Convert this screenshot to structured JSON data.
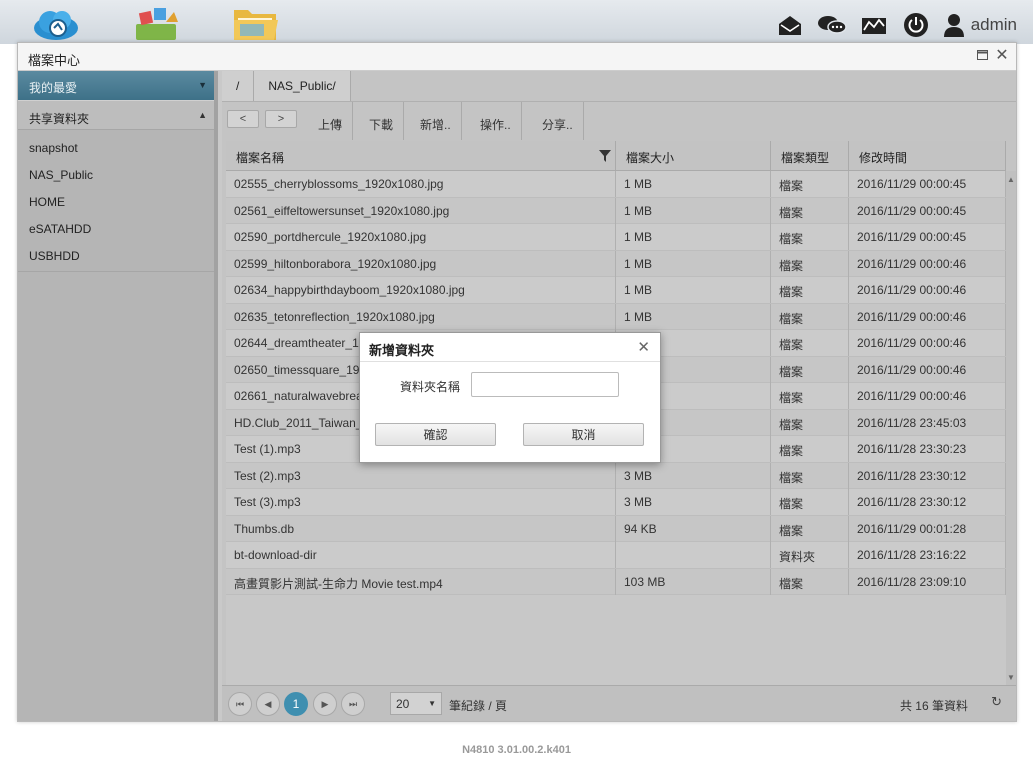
{
  "topbar": {
    "apps": [
      {
        "name": "cloud-app-icon"
      },
      {
        "name": "app-store-icon"
      },
      {
        "name": "file-center-icon"
      }
    ],
    "username": "admin"
  },
  "window": {
    "title": "檔案中心"
  },
  "sidebar": {
    "favorites_label": "我的最愛",
    "shared_label": "共享資料夾",
    "items": [
      {
        "label": "snapshot"
      },
      {
        "label": "NAS_Public"
      },
      {
        "label": "HOME"
      },
      {
        "label": "eSATAHDD"
      },
      {
        "label": "USBHDD"
      }
    ]
  },
  "breadcrumb": [
    "/",
    "NAS_Public/"
  ],
  "toolbar": {
    "back": "<",
    "forward": ">",
    "buttons": [
      {
        "label": "上傳"
      },
      {
        "label": "下載"
      },
      {
        "label": "新增.."
      },
      {
        "label": "操作.."
      },
      {
        "label": "分享.."
      }
    ]
  },
  "table": {
    "columns": [
      "檔案名稱",
      "檔案大小",
      "檔案類型",
      "修改時間"
    ],
    "rows": [
      {
        "name": "02555_cherryblossoms_1920x1080.jpg",
        "size": "1 MB",
        "type": "檔案",
        "modified": "2016/11/29 00:00:45"
      },
      {
        "name": "02561_eiffeltowersunset_1920x1080.jpg",
        "size": "1 MB",
        "type": "檔案",
        "modified": "2016/11/29 00:00:45"
      },
      {
        "name": "02590_portdhercule_1920x1080.jpg",
        "size": "1 MB",
        "type": "檔案",
        "modified": "2016/11/29 00:00:45"
      },
      {
        "name": "02599_hiltonborabora_1920x1080.jpg",
        "size": "1 MB",
        "type": "檔案",
        "modified": "2016/11/29 00:00:46"
      },
      {
        "name": "02634_happybirthdayboom_1920x1080.jpg",
        "size": "1 MB",
        "type": "檔案",
        "modified": "2016/11/29 00:00:46"
      },
      {
        "name": "02635_tetonreflection_1920x1080.jpg",
        "size": "1 MB",
        "type": "檔案",
        "modified": "2016/11/29 00:00:46"
      },
      {
        "name": "02644_dreamtheater_1",
        "size": "",
        "type": "檔案",
        "modified": "2016/11/29 00:00:46"
      },
      {
        "name": "02650_timessquare_19",
        "size": "",
        "type": "檔案",
        "modified": "2016/11/29 00:00:46"
      },
      {
        "name": "02661_naturalwavebrea",
        "size": "",
        "type": "檔案",
        "modified": "2016/11/29 00:00:46"
      },
      {
        "name": "HD.Club_2011_Taiwan_",
        "size": "",
        "type": "檔案",
        "modified": "2016/11/28 23:45:03"
      },
      {
        "name": "Test (1).mp3",
        "size": "",
        "type": "檔案",
        "modified": "2016/11/28 23:30:23"
      },
      {
        "name": "Test (2).mp3",
        "size": "3 MB",
        "type": "檔案",
        "modified": "2016/11/28 23:30:12"
      },
      {
        "name": "Test (3).mp3",
        "size": "3 MB",
        "type": "檔案",
        "modified": "2016/11/28 23:30:12"
      },
      {
        "name": "Thumbs.db",
        "size": "94 KB",
        "type": "檔案",
        "modified": "2016/11/29 00:01:28"
      },
      {
        "name": "bt-download-dir",
        "size": "",
        "type": "資料夾",
        "modified": "2016/11/28 23:16:22"
      },
      {
        "name": "高畫質影片測試-生命力 Movie test.mp4",
        "size": "103 MB",
        "type": "檔案",
        "modified": "2016/11/28 23:09:10"
      }
    ]
  },
  "pager": {
    "current_page": "1",
    "page_size": "20",
    "unit_label": "筆紀錄 / 頁",
    "total_label": "共 16 筆資料"
  },
  "dialog": {
    "title": "新增資料夾",
    "field_label": "資料夾名稱",
    "field_value": "",
    "ok_label": "確認",
    "cancel_label": "取消"
  },
  "footer": {
    "version": "N4810   3.01.00.2.k401"
  },
  "colors": {
    "accent": "#3f8fb0",
    "favorites_bg": "#4a7e95"
  }
}
